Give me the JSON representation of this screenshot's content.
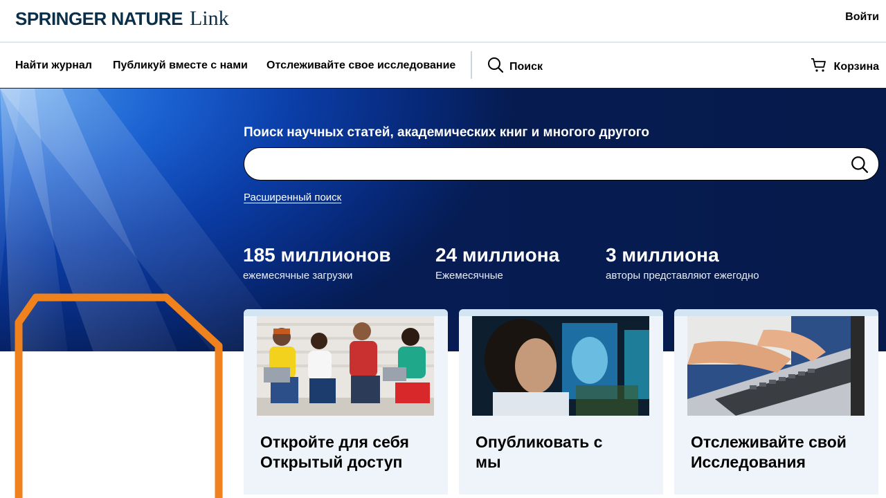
{
  "header": {
    "logo_brand": "SPRINGER NATURE",
    "logo_link": "Link",
    "login": "Войти"
  },
  "nav": {
    "items": [
      {
        "label": "Найти журнал"
      },
      {
        "label": "Публикуй вместе с нами"
      },
      {
        "label": "Отслеживайте свое исследование"
      }
    ],
    "search": "Поиск",
    "cart": "Корзина"
  },
  "hero": {
    "title": "Поиск научных статей, академических книг и многого другого",
    "search_value": "",
    "advanced_search": "Расширенный поиск",
    "stats": [
      {
        "value": "185 миллионов",
        "label": "ежемесячные загрузки"
      },
      {
        "value": "24 миллиона",
        "label": "Ежемесячные"
      },
      {
        "value": "3 миллиона",
        "label": "авторы представляют ежегодно"
      }
    ]
  },
  "cards": [
    {
      "line1": "Откройте для себя",
      "line2": "Открытый доступ",
      "image": "group-with-laptops"
    },
    {
      "line1": "Опубликовать с",
      "line2": "мы",
      "image": "researcher-with-monitors"
    },
    {
      "line1": "Отслеживайте свой",
      "line2": "Исследования",
      "image": "typing-on-laptop"
    }
  ],
  "colors": {
    "brand_navy": "#0b2f48",
    "hero_blue": "#0b3ea8",
    "accent_orange": "#f0821e",
    "card_bg": "#eef4fa"
  }
}
